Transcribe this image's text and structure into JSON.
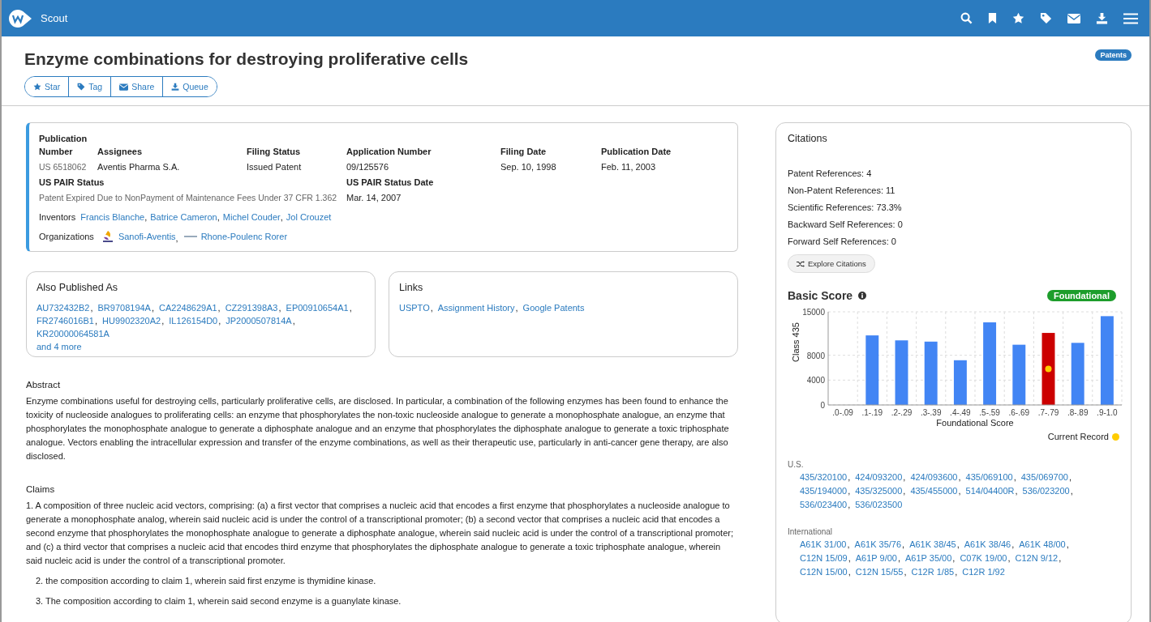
{
  "app": {
    "name": "Scout"
  },
  "document": {
    "title": "Enzyme combinations for destroying proliferative cells",
    "badge": "Patents",
    "actions": [
      {
        "kind": "star",
        "label": "Star"
      },
      {
        "kind": "tag",
        "label": "Tag"
      },
      {
        "kind": "mail",
        "label": "Share"
      },
      {
        "kind": "download",
        "label": "Queue"
      }
    ]
  },
  "list_separator": ",",
  "details": {
    "columns": [
      {
        "label": "Publication Number",
        "value": "US 6518062",
        "muted": true
      },
      {
        "label": "Assignees",
        "value": "Aventis Pharma S.A.",
        "muted": false
      },
      {
        "label": "Filing Status",
        "value": "Issued Patent",
        "muted": false
      },
      {
        "label": "Application Number",
        "value": "09/125576",
        "muted": false
      },
      {
        "label": "Filing Date",
        "value": "Sep. 10, 1998",
        "muted": false
      },
      {
        "label": "Publication Date",
        "value": "Feb. 11, 2003",
        "muted": false
      }
    ],
    "pair_status": {
      "label": "US PAIR Status",
      "value": "Patent Expired Due to NonPayment of Maintenance Fees Under 37 CFR 1.362"
    },
    "pair_date": {
      "label": "US PAIR Status Date",
      "value": "Mar. 14, 2007"
    },
    "inventors": {
      "label": "Inventors",
      "names": [
        "Francis Blanche",
        "Batrice Cameron",
        "Michel Couder",
        "Jol Crouzet"
      ]
    },
    "organizations": {
      "label": "Organizations",
      "names": [
        "Sanofi-Aventis",
        "Rhone-Poulenc Rorer"
      ]
    }
  },
  "also_published": {
    "title": "Also Published As",
    "items": [
      "AU732432B2",
      "BR9708194A",
      "CA2248629A1",
      "CZ291398A3",
      "EP00910654A1",
      "FR2746016B1",
      "HU9902320A2",
      "IL126154D0",
      "JP2000507814A",
      "KR20000064581A"
    ],
    "more": "and 4 more"
  },
  "links": {
    "title": "Links",
    "items": [
      "USPTO",
      "Assignment History",
      "Google Patents"
    ]
  },
  "abstract": {
    "title": "Abstract",
    "text": "Enzyme combinations useful for destroying cells, particularly proliferative cells, are disclosed. In particular, a combination of the following enzymes has been found to enhance the toxicity of nucleoside analogues to proliferating cells: an enzyme that phosphorylates the non-toxic nucleoside analogue to generate a monophosphate analogue, an enzyme that phosphorylates the monophosphate analogue to generate a diphosphate analogue and an enzyme that phosphorylates the diphosphate analogue to generate a toxic triphosphate analogue. Vectors enabling the intracellular expression and transfer of the enzyme combinations, as well as their therapeutic use, particularly in anti-cancer gene therapy, are also disclosed."
  },
  "claims": {
    "title": "Claims",
    "items": [
      {
        "indented": false,
        "text": "1. A composition of three nucleic acid vectors, comprising: (a) a first vector that comprises a nucleic acid that encodes a first enzyme that phosphorylates a nucleoside analogue to generate a monophosphate analog, wherein said nucleic acid is under the control of a transcriptional promoter; (b) a second vector that comprises a nucleic acid that encodes a second enzyme that phosphorylates the monophosphate analogue to generate a diphosphate analogue, wherein said nucleic acid is under the control of a transcriptional promoter; and (c) a third vector that comprises a nucleic acid that encodes third enzyme that phosphorylates the diphosphate analogue to generate a toxic triphosphate analogue, wherein said nucleic acid is under the control of a transcriptional promoter."
      },
      {
        "indented": true,
        "text": "2. the composition according to claim 1, wherein said first enzyme is thymidine kinase."
      },
      {
        "indented": true,
        "text": "3. The composition according to claim 1, wherein said second enzyme is a guanylate kinase."
      }
    ]
  },
  "citations": {
    "title": "Citations",
    "stats": [
      "Patent References: 4",
      "Non-Patent References: 11",
      "Scientific References: 73.3%",
      "Backward Self References: 0",
      "Forward Self References: 0"
    ],
    "button": "Explore Citations"
  },
  "basic_score": {
    "title": "Basic Score",
    "badge": "Foundational",
    "chart_data": {
      "type": "bar",
      "xlabel": "Foundational Score",
      "ylabel": "Class 435",
      "categories": [
        ".0-.09",
        ".1-.19",
        ".2-.29",
        ".3-.39",
        ".4-.49",
        ".5-.59",
        ".6-.69",
        ".7-.79",
        ".8-.89",
        ".9-1.0"
      ],
      "values": [
        0,
        11200,
        10400,
        10200,
        7200,
        13300,
        9700,
        11600,
        10000,
        14300
      ],
      "ylim": [
        0,
        15000
      ],
      "yticks": [
        0,
        4000,
        8000,
        15000
      ]
    },
    "bars": [
      {
        "current": false
      },
      {
        "current": false
      },
      {
        "current": false
      },
      {
        "current": false
      },
      {
        "current": false
      },
      {
        "current": false
      },
      {
        "current": false
      },
      {
        "current": true
      },
      {
        "current": false
      },
      {
        "current": false
      }
    ],
    "legend": {
      "label": "Current Record"
    }
  },
  "classifications": [
    {
      "label": "U.S.",
      "codes": [
        "435/320100",
        "424/093200",
        "424/093600",
        "435/069100",
        "435/069700",
        "435/194000",
        "435/325000",
        "435/455000",
        "514/04400R",
        "536/023200",
        "536/023400",
        "536/023500"
      ]
    },
    {
      "label": "International",
      "codes": [
        "A61K 31/00",
        "A61K 35/76",
        "A61K 38/45",
        "A61K 38/46",
        "A61K 48/00",
        "C12N 15/09",
        "A61P 9/00",
        "A61P 35/00",
        "C07K 19/00",
        "C12N 9/12",
        "C12N 15/00",
        "C12N 15/55",
        "C12R 1/85",
        "C12R 1/92"
      ]
    }
  ]
}
